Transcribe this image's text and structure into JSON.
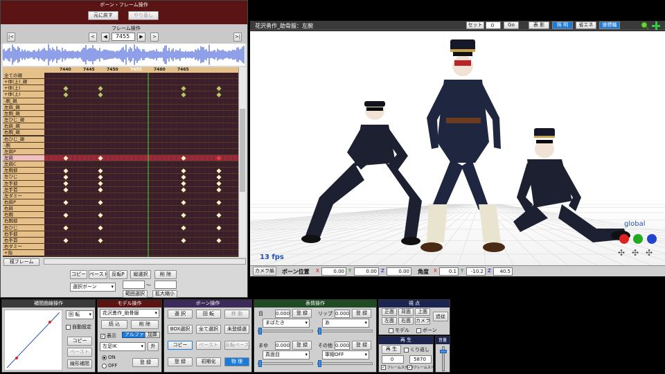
{
  "bone_frame_panel": {
    "title": "ボーン・フレーム操作",
    "undo": "元に戻す",
    "redo": "やり直し",
    "frame_ops_title": "フレーム操作",
    "frame_value": "7455",
    "nav_first": "|<",
    "nav_prev_key": "<",
    "nav_prev": "◀",
    "nav_next": "▶",
    "nav_next_key": ">",
    "nav_last": ">|",
    "ticks": [
      "7440",
      "7445",
      "7450",
      "7455",
      "7460",
      "7465"
    ],
    "bones": [
      "全ての親",
      "+体(上)_親",
      "+体(上)",
      "+体(上)",
      "-腕_親",
      "左肩_親",
      "左腕_親",
      "左ひじ_親",
      "右肩_親",
      "右腕_親",
      "右ひじ_親",
      "-腕",
      "左肩P",
      "左肩",
      "左肩C",
      "左腕捩",
      "左ひじ",
      "左手捩",
      "左手首",
      "左ダミー",
      "右肩P",
      "右肩",
      "右腕",
      "右腕捩",
      "右ひじ",
      "右手捩",
      "右手首",
      "右ダミー",
      "+指"
    ],
    "footer_label": "視フレーム",
    "copy": "コピー",
    "paste": "ペースト",
    "reverse_paste": "反転P",
    "vert_select": "縦選択",
    "delete": "削 除",
    "bone_select": "選択ボーン",
    "tilde": "～",
    "range_select": "範囲選択",
    "zoom": "拡大縮小"
  },
  "viewport": {
    "title": "花沢勇作_助骨服：左腕",
    "set_label": "セット",
    "set_value": "0",
    "go": "Go",
    "buttons": [
      "表 影",
      "照 明",
      "省エネ",
      "座標軸"
    ],
    "fps": "13 fps",
    "global": "global"
  },
  "bone_bar": {
    "camera_tab": "カメラ編",
    "pos_label": "ボーン位置",
    "x": "0.00",
    "y": "0.00",
    "z": "0.00",
    "angle_label": "角度",
    "ax": "0.1",
    "ay": "-10.2",
    "az": "40.5"
  },
  "curve_panel": {
    "title": "補間曲線操作",
    "rotate": "回 転",
    "auto": "自動設定",
    "copy": "コピー",
    "paste": "ペースト",
    "linear": "線形補間"
  },
  "model_panel": {
    "title": "モデル操作",
    "model": "花沢勇作_助骨服",
    "load": "読 込",
    "delete": "削 除",
    "show": "表示",
    "alpha": "アルファ",
    "add": "加算",
    "foot": "左足IK",
    "outer": "外",
    "on": "ON",
    "off": "OFF",
    "register": "登 録"
  },
  "bone_panel": {
    "title": "ボーン操作",
    "select": "選 択",
    "rotate": "回 転",
    "move": "移 動",
    "box": "BOX選択",
    "all": "全て選択",
    "unreg": "未登録選",
    "copy": "コピー",
    "paste": "ペースト",
    "rev": "反転ペースト",
    "register": "登 録",
    "init": "初期化",
    "physics": "物 理"
  },
  "facial_panel": {
    "title": "表情操作",
    "eye": "目",
    "eye_val": "0.000",
    "eye_sel": "まばたき",
    "lip": "リップ",
    "lip_val": "0.000",
    "lip_sel": "あ",
    "brow": "まゆ",
    "brow_val": "0.000",
    "brow_sel": "真面目",
    "other": "その他",
    "other_val": "0.000",
    "other_sel": "軍帽OFF",
    "register": "登 録"
  },
  "view_panel": {
    "title": "視 点",
    "front": "正面",
    "back": "背面",
    "top": "上面",
    "follow": "追従",
    "left": "左面",
    "right": "右面",
    "camera": "カメラ",
    "model": "モデル",
    "bone": "ボーン"
  },
  "play_panel": {
    "title": "再 生",
    "play": "再 生",
    "repeat": "くり返し",
    "start": "0",
    "end": "5870",
    "frame_start": "フレームスタート",
    "frame_stop": "フレームストップ",
    "volume": "音量"
  },
  "colors": {
    "panel_red": "#5a1414",
    "panel_purple": "#3c2a5a",
    "panel_green": "#1e4a24",
    "panel_navy": "#1c2450",
    "accent_blue": "#1c7ad8"
  }
}
